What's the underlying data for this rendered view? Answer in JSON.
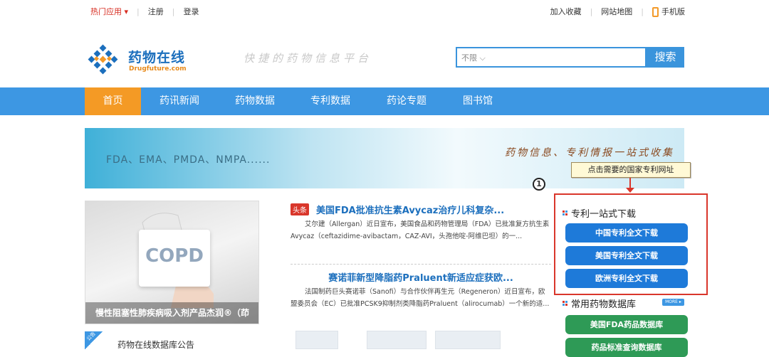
{
  "topbar": {
    "hot_apps": "热门应用",
    "register": "注册",
    "login": "登录",
    "favorite": "加入收藏",
    "sitemap": "网站地图",
    "mobile": "手机版"
  },
  "header": {
    "logo_cn": "药物在线",
    "logo_en": "Drugfuture.com",
    "slogan": "快捷的药物信息平台",
    "search_scope": "不限",
    "search_button": "搜索"
  },
  "nav": {
    "items": [
      "首页",
      "药讯新闻",
      "药物数据",
      "专利数据",
      "药论专题",
      "图书馆"
    ]
  },
  "banner": {
    "left_text": "FDA、EMA、PMDA、NMPA......",
    "right_text": "药物信息、专利情报一站式收集"
  },
  "feature": {
    "image_text": "COPD",
    "caption": "慢性阻塞性肺疾病吸入剂产品杰润®（茚"
  },
  "news": [
    {
      "badge": "头条",
      "title": "美国FDA批准抗生素Avycaz治疗儿科复杂...",
      "body": "艾尔建（Allergan）近日宣布，美国食品和药物管理局（FDA）已批准复方抗生素Avycaz（ceftazidime-avibactam，CAZ-AVI，头孢他啶-阿维巴坦）的一..."
    },
    {
      "title": "赛诺菲新型降脂药Praluent新适应症获欧...",
      "body": "法国制药巨头赛诺菲（Sanofi）与合作伙伴再生元（Regeneron）近日宣布，欧盟委员会（EC）已批准PCSK9抑制剂类降脂药Praluent（alirocumab）一个新的适..."
    }
  ],
  "notice": {
    "corner": "公告",
    "title": "药物在线数据库公告"
  },
  "annotation": {
    "callout": "点击需要的国家专利网址",
    "step": "1"
  },
  "patent_panel": {
    "title": "专利一站式下载",
    "buttons": [
      "中国专利全文下载",
      "美国专利全文下载",
      "欧洲专利全文下载"
    ]
  },
  "db_panel": {
    "title": "常用药物数据库",
    "more": "MORE ▸",
    "buttons": [
      "美国FDA药品数据库",
      "药品标准查询数据库"
    ]
  },
  "colors": {
    "brand_blue": "#3d97e3",
    "active_orange": "#f49a25",
    "download_blue": "#1e7ad9",
    "db_green": "#2e9a56",
    "highlight_red": "#d9362b"
  }
}
